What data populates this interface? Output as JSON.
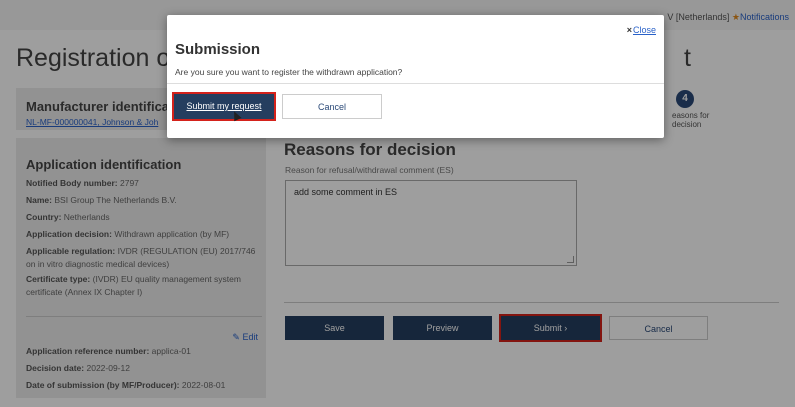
{
  "topbar": {
    "user_text": "V [Netherlands]",
    "notifications_label": "Notifications"
  },
  "page": {
    "title": "Registration of a",
    "title_tail": "t"
  },
  "manufacturer": {
    "heading": "Manufacturer identificati",
    "link": "NL-MF-000000041, Johnson & Joh"
  },
  "application": {
    "heading": "Application identification",
    "notified_body_label": "Notified Body number:",
    "notified_body_value": "2797",
    "name_label": "Name:",
    "name_value": "BSI Group The Netherlands B.V.",
    "country_label": "Country:",
    "country_value": "Netherlands",
    "decision_label": "Application decision:",
    "decision_value": "Withdrawn application (by MF)",
    "regulation_label": "Applicable regulation:",
    "regulation_value": "IVDR (REGULATION (EU) 2017/746 on in vitro diagnostic medical devices)",
    "cert_type_label": "Certificate type:",
    "cert_type_value": "(IVDR) EU quality management system certificate (Annex IX Chapter I)",
    "edit_label": "Edit",
    "ref_label": "Application reference number:",
    "ref_value": "applica-01",
    "decision_date_label": "Decision date:",
    "decision_date_value": "2022-09-12",
    "submission_date_label": "Date of submission (by MF/Producer):",
    "submission_date_value": "2022-08-01"
  },
  "steps": {
    "current_number": "4",
    "current_label_line1": "easons for",
    "current_label_line2": "decision"
  },
  "reasons": {
    "heading": "Reasons for decision",
    "field_label": "Reason for refusal/withdrawal comment (ES)",
    "field_value": "add some comment in ES"
  },
  "actions": {
    "save": "Save",
    "preview": "Preview",
    "submit": "Submit",
    "cancel": "Cancel"
  },
  "modal": {
    "title": "Submission",
    "message": "Are you sure you want to register the withdrawn application?",
    "close_label": "Close",
    "submit_label": "Submit my request",
    "cancel_label": "Cancel"
  }
}
